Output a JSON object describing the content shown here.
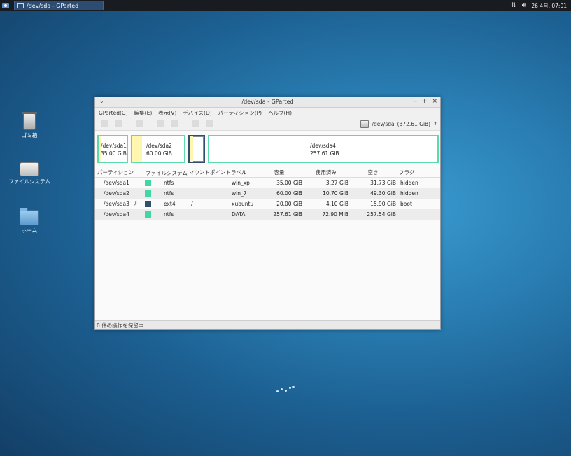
{
  "panel": {
    "task_title": "/dev/sda - GParted",
    "clock": "26 4月, 07:01"
  },
  "desktop": {
    "icons": [
      {
        "label": "ゴミ箱",
        "icon": "trash-icon"
      },
      {
        "label": "ファイルシステム",
        "icon": "drive-icon"
      },
      {
        "label": "ホーム",
        "icon": "home-folder-icon"
      }
    ]
  },
  "window": {
    "title": "/dev/sda - GParted",
    "menu": [
      "GParted(G)",
      "編集(E)",
      "表示(V)",
      "デバイス(D)",
      "パーティション(P)",
      "ヘルプ(H)"
    ],
    "device": "/dev/sda",
    "device_size": "(372.61 GiB)",
    "diskmap": [
      {
        "name": "/dev/sda1",
        "size": "35.00 GiB"
      },
      {
        "name": "/dev/sda2",
        "size": "60.00 GiB"
      },
      {
        "name": "",
        "size": ""
      },
      {
        "name": "/dev/sda4",
        "size": "257.61 GiB"
      }
    ],
    "columns": [
      "パーティション",
      "ファイルシステム",
      "マウントポイント",
      "ラベル",
      "容量",
      "使用済み",
      "空き",
      "フラグ"
    ],
    "rows": [
      {
        "partition": "/dev/sda1",
        "fs": "ntfs",
        "fs_color": "#42d6a4",
        "mount": "",
        "label": "win_xp",
        "size": "35.00 GiB",
        "used": "3.27 GiB",
        "free": "31.73 GiB",
        "flags": "hidden"
      },
      {
        "partition": "/dev/sda2",
        "fs": "ntfs",
        "fs_color": "#42d6a4",
        "mount": "",
        "label": "win_7",
        "size": "60.00 GiB",
        "used": "10.70 GiB",
        "free": "49.30 GiB",
        "flags": "hidden"
      },
      {
        "partition": "/dev/sda3",
        "fs": "ext4",
        "fs_color": "#314e6c",
        "mount": "/",
        "label": "xubuntu",
        "size": "20.00 GiB",
        "used": "4.10 GiB",
        "free": "15.90 GiB",
        "flags": "boot"
      },
      {
        "partition": "/dev/sda4",
        "fs": "ntfs",
        "fs_color": "#42d6a4",
        "mount": "",
        "label": "DATA",
        "size": "257.61 GiB",
        "used": "72.90 MiB",
        "free": "257.54 GiB",
        "flags": ""
      }
    ],
    "status": "0 件の操作を保留中"
  },
  "colors": {
    "partition_border": "#5ed9ab",
    "used_fill": "#fff6b0",
    "ntfs": "#42d6a4",
    "ext4": "#314e6c"
  }
}
